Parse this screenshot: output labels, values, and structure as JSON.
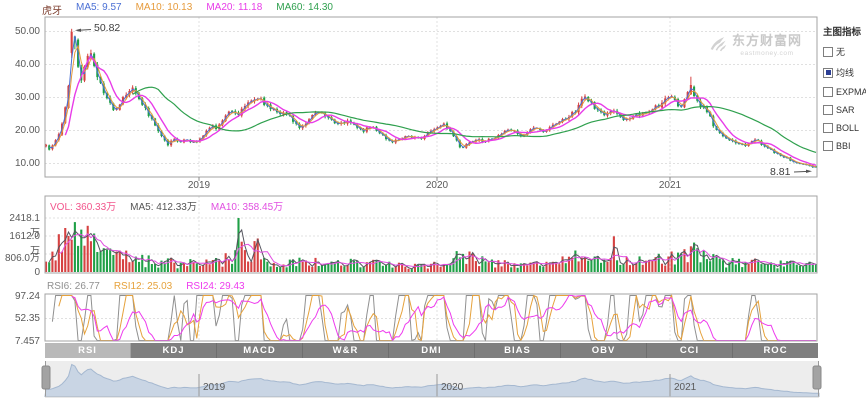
{
  "app": {
    "watermark_title": "东方财富网",
    "watermark_domain": "eastmoney.com"
  },
  "annotations": {
    "peak": "50.82",
    "last": "8.81"
  },
  "sidebar": {
    "title": "主图指标",
    "items": [
      {
        "label": "无",
        "checked": false
      },
      {
        "label": "均线",
        "checked": true
      },
      {
        "label": "EXPMA",
        "checked": false
      },
      {
        "label": "SAR",
        "checked": false
      },
      {
        "label": "BOLL",
        "checked": false
      },
      {
        "label": "BBI",
        "checked": false
      }
    ]
  },
  "tabs": {
    "items": [
      {
        "label": "RSI",
        "active": true
      },
      {
        "label": "KDJ",
        "active": false
      },
      {
        "label": "MACD",
        "active": false
      },
      {
        "label": "W&R",
        "active": false
      },
      {
        "label": "DMI",
        "active": false
      },
      {
        "label": "BIAS",
        "active": false
      },
      {
        "label": "OBV",
        "active": false
      },
      {
        "label": "CCI",
        "active": false
      },
      {
        "label": "ROC",
        "active": false
      }
    ]
  },
  "chart_data": [
    {
      "id": "price-main",
      "type": "candlestick",
      "symbol": "虎牙",
      "legend": [
        {
          "label": "虎牙",
          "color": "#7b3b2b"
        },
        {
          "label": "MA5: 9.57",
          "color": "#4a6fd4"
        },
        {
          "label": "MA10: 10.13",
          "color": "#e69b3c"
        },
        {
          "label": "MA20: 11.18",
          "color": "#e83ce8"
        },
        {
          "label": "MA60: 14.30",
          "color": "#2fa04e"
        }
      ],
      "colors": {
        "up": "#d64242",
        "down": "#1fa046"
      },
      "ma_colors": [
        "#4a6fd4",
        "#e69b3c",
        "#e83ce8",
        "#2fa04e"
      ],
      "yticks": [
        {
          "label": "50.00",
          "value": 50
        },
        {
          "label": "40.00",
          "value": 40
        },
        {
          "label": "30.00",
          "value": 30
        },
        {
          "label": "20.00",
          "value": 20
        },
        {
          "label": "10.00",
          "value": 10
        }
      ],
      "xticks": [
        "2019",
        "2020",
        "2021"
      ],
      "ylim": [
        5.8,
        54.4
      ],
      "annotations": [
        {
          "text": "50.82",
          "target": "all-time-high"
        },
        {
          "text": "8.81",
          "target": "latest-close"
        }
      ],
      "points": [
        [
          46,
          15.8
        ],
        [
          50,
          13.9
        ],
        [
          55,
          16.5
        ],
        [
          60,
          20
        ],
        [
          64,
          24
        ],
        [
          68,
          32
        ],
        [
          72,
          46
        ],
        [
          74,
          50
        ],
        [
          77,
          41
        ],
        [
          80,
          34
        ],
        [
          84,
          38
        ],
        [
          88,
          44
        ],
        [
          92,
          42
        ],
        [
          96,
          38
        ],
        [
          100,
          34.5
        ],
        [
          105,
          31
        ],
        [
          110,
          28
        ],
        [
          115,
          25.5
        ],
        [
          120,
          28
        ],
        [
          126,
          31
        ],
        [
          132,
          33.5
        ],
        [
          138,
          30
        ],
        [
          144,
          27
        ],
        [
          150,
          24
        ],
        [
          156,
          21
        ],
        [
          162,
          18
        ],
        [
          168,
          15.8
        ],
        [
          174,
          17.5
        ],
        [
          180,
          16
        ],
        [
          186,
          17.8
        ],
        [
          192,
          16.2
        ],
        [
          199,
          17
        ],
        [
          205,
          19.5
        ],
        [
          211,
          21.5
        ],
        [
          217,
          20.5
        ],
        [
          224,
          23.5
        ],
        [
          230,
          26
        ],
        [
          237,
          24.5
        ],
        [
          244,
          27
        ],
        [
          251,
          29
        ],
        [
          258,
          30
        ],
        [
          265,
          28
        ],
        [
          272,
          26.5
        ],
        [
          279,
          24.5
        ],
        [
          286,
          25.5
        ],
        [
          293,
          23
        ],
        [
          300,
          21
        ],
        [
          307,
          22.5
        ],
        [
          314,
          25
        ],
        [
          321,
          25.8
        ],
        [
          328,
          24
        ],
        [
          335,
          22.5
        ],
        [
          342,
          21.8
        ],
        [
          349,
          23.2
        ],
        [
          356,
          21.2
        ],
        [
          363,
          19.8
        ],
        [
          370,
          21.3
        ],
        [
          377,
          20
        ],
        [
          384,
          18.2
        ],
        [
          391,
          16.6
        ],
        [
          398,
          17
        ],
        [
          405,
          18.4
        ],
        [
          412,
          17.8
        ],
        [
          419,
          17.4
        ],
        [
          426,
          18.6
        ],
        [
          430,
          19.8
        ],
        [
          437,
          20.6
        ],
        [
          444,
          21.8
        ],
        [
          450,
          20
        ],
        [
          456,
          17
        ],
        [
          461,
          14.2
        ],
        [
          466,
          15.5
        ],
        [
          472,
          16.8
        ],
        [
          478,
          17.6
        ],
        [
          484,
          16.4
        ],
        [
          490,
          17.4
        ],
        [
          497,
          18.3
        ],
        [
          504,
          19.4
        ],
        [
          510,
          20.3
        ],
        [
          516,
          19.2
        ],
        [
          522,
          18.2
        ],
        [
          528,
          19.6
        ],
        [
          534,
          21
        ],
        [
          540,
          20.4
        ],
        [
          546,
          19.6
        ],
        [
          552,
          21.2
        ],
        [
          558,
          22.6
        ],
        [
          564,
          23.4
        ],
        [
          570,
          24.6
        ],
        [
          576,
          26
        ],
        [
          581,
          29
        ],
        [
          586,
          30.5
        ],
        [
          591,
          28
        ],
        [
          598,
          26
        ],
        [
          606,
          24.5
        ],
        [
          613,
          26
        ],
        [
          620,
          24
        ],
        [
          628,
          23
        ],
        [
          636,
          24.5
        ],
        [
          644,
          25.5
        ],
        [
          652,
          26.5
        ],
        [
          660,
          28
        ],
        [
          666,
          30
        ],
        [
          671,
          31.5
        ],
        [
          676,
          28.5
        ],
        [
          681,
          27
        ],
        [
          686,
          30
        ],
        [
          690,
          33.5
        ],
        [
          694,
          31
        ],
        [
          698,
          28.5
        ],
        [
          704,
          26.5
        ],
        [
          710,
          24.5
        ],
        [
          714,
          21
        ],
        [
          720,
          19
        ],
        [
          726,
          17.8
        ],
        [
          732,
          17
        ],
        [
          738,
          16.2
        ],
        [
          744,
          15.4
        ],
        [
          750,
          16.4
        ],
        [
          756,
          17.2
        ],
        [
          762,
          15.8
        ],
        [
          768,
          14.6
        ],
        [
          774,
          13.4
        ],
        [
          780,
          12.6
        ],
        [
          786,
          11.8
        ],
        [
          792,
          10.8
        ],
        [
          798,
          10.2
        ],
        [
          804,
          9.7
        ],
        [
          810,
          9.2
        ],
        [
          816,
          8.81
        ]
      ],
      "wick_extremes": [
        [
          72,
          50.82
        ],
        [
          690,
          36.3
        ]
      ]
    },
    {
      "id": "volume",
      "type": "bar",
      "legend": [
        {
          "label": "VOL: 360.33万",
          "color": "#f2558c"
        },
        {
          "label": "MA5: 412.33万",
          "color": "#555555"
        },
        {
          "label": "MA10: 358.45万",
          "color": "#e14fe1"
        }
      ],
      "yticks": [
        {
          "label": "2418.1万",
          "value": 2418.1
        },
        {
          "label": "1612.0万",
          "value": 1612
        },
        {
          "label": "806.0万",
          "value": 806
        },
        {
          "label": "0",
          "value": 0
        }
      ],
      "points": [
        [
          46,
          700
        ],
        [
          55,
          1000
        ],
        [
          65,
          1400
        ],
        [
          72,
          1700
        ],
        [
          80,
          1900
        ],
        [
          88,
          1400
        ],
        [
          96,
          1000
        ],
        [
          110,
          750
        ],
        [
          125,
          650
        ],
        [
          140,
          520
        ],
        [
          160,
          430
        ],
        [
          180,
          380
        ],
        [
          199,
          360
        ],
        [
          210,
          420
        ],
        [
          224,
          520
        ],
        [
          232,
          600
        ],
        [
          237,
          2418
        ],
        [
          242,
          800
        ],
        [
          250,
          650
        ],
        [
          258,
          1500
        ],
        [
          263,
          700
        ],
        [
          272,
          520
        ],
        [
          285,
          450
        ],
        [
          300,
          400
        ],
        [
          315,
          480
        ],
        [
          330,
          420
        ],
        [
          345,
          380
        ],
        [
          360,
          360
        ],
        [
          375,
          340
        ],
        [
          390,
          320
        ],
        [
          405,
          300
        ],
        [
          420,
          290
        ],
        [
          437,
          340
        ],
        [
          450,
          420
        ],
        [
          461,
          780
        ],
        [
          472,
          560
        ],
        [
          484,
          420
        ],
        [
          500,
          380
        ],
        [
          515,
          340
        ],
        [
          530,
          380
        ],
        [
          545,
          360
        ],
        [
          560,
          420
        ],
        [
          576,
          640
        ],
        [
          581,
          900
        ],
        [
          590,
          520
        ],
        [
          600,
          460
        ],
        [
          613,
          1600
        ],
        [
          620,
          560
        ],
        [
          630,
          480
        ],
        [
          645,
          420
        ],
        [
          660,
          520
        ],
        [
          671,
          640
        ],
        [
          681,
          560
        ],
        [
          690,
          1150
        ],
        [
          698,
          800
        ],
        [
          708,
          560
        ],
        [
          720,
          460
        ],
        [
          732,
          420
        ],
        [
          744,
          380
        ],
        [
          756,
          420
        ],
        [
          768,
          360
        ],
        [
          780,
          340
        ],
        [
          792,
          330
        ],
        [
          804,
          340
        ],
        [
          816,
          360
        ]
      ],
      "spikes": [
        [
          80,
          1900
        ],
        [
          237,
          2418
        ],
        [
          258,
          1500
        ],
        [
          613,
          1600
        ],
        [
          690,
          1150
        ],
        [
          816,
          360
        ]
      ]
    },
    {
      "id": "rsi",
      "type": "line",
      "legend": [
        {
          "label": "RSI6: 26.77",
          "color": "#909090"
        },
        {
          "label": "RSI12: 25.03",
          "color": "#e6a23c"
        },
        {
          "label": "RSI24: 29.43",
          "color": "#ee3cee"
        }
      ],
      "yticks": [
        {
          "label": "97.24",
          "value": 97.24
        },
        {
          "label": "52.35",
          "value": 52.35
        },
        {
          "label": "7.457",
          "value": 7.457
        }
      ],
      "windows": [
        6,
        12,
        24
      ]
    },
    {
      "id": "navigator",
      "type": "area",
      "xticks": [
        "2019",
        "2020",
        "2021"
      ],
      "fill": "#c9d5e4",
      "line": "#a5b8d0"
    }
  ]
}
